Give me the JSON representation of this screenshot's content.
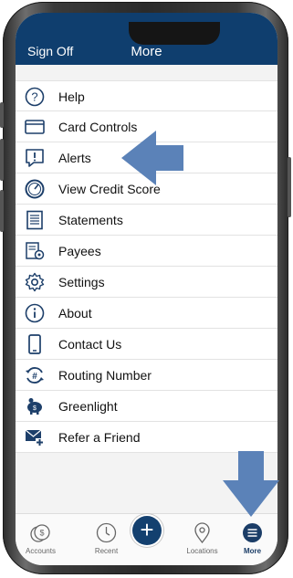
{
  "header": {
    "signoff_label": "Sign Off",
    "title": "More"
  },
  "menu": {
    "items": [
      {
        "label": "Help",
        "icon": "help-icon"
      },
      {
        "label": "Card Controls",
        "icon": "card-icon"
      },
      {
        "label": "Alerts",
        "icon": "alert-icon"
      },
      {
        "label": "View Credit Score",
        "icon": "gauge-icon"
      },
      {
        "label": "Statements",
        "icon": "document-icon"
      },
      {
        "label": "Payees",
        "icon": "payees-icon"
      },
      {
        "label": "Settings",
        "icon": "gear-icon"
      },
      {
        "label": "About",
        "icon": "info-icon"
      },
      {
        "label": "Contact Us",
        "icon": "phone-icon"
      },
      {
        "label": "Routing Number",
        "icon": "routing-number-icon"
      },
      {
        "label": "Greenlight",
        "icon": "piggy-bank-icon"
      },
      {
        "label": "Refer a Friend",
        "icon": "refer-friend-icon"
      }
    ]
  },
  "tabbar": {
    "tabs": [
      {
        "label": "Accounts",
        "icon": "accounts-icon",
        "active": false
      },
      {
        "label": "Recent",
        "icon": "clock-icon",
        "active": false
      },
      {
        "label": "",
        "icon": "plus-icon",
        "active": false
      },
      {
        "label": "Locations",
        "icon": "location-pin-icon",
        "active": false
      },
      {
        "label": "More",
        "icon": "menu-icon",
        "active": true
      }
    ]
  },
  "colors": {
    "header": "#0f3e6e",
    "accent": "#1b3d67",
    "annotation_arrow": "#5b82b8"
  }
}
